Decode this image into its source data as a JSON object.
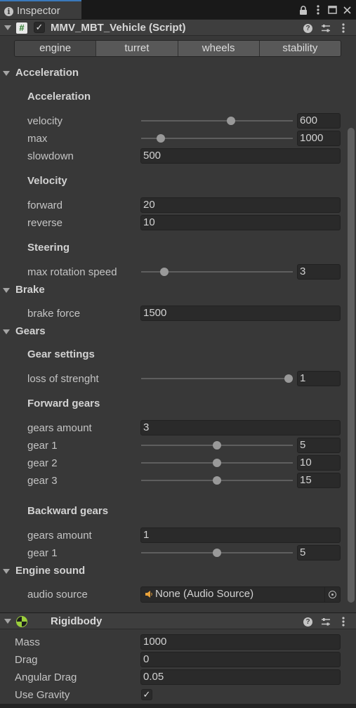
{
  "window": {
    "tab_title": "Inspector",
    "tools": [
      "lock-icon",
      "menu-icon",
      "maximize-icon",
      "close-icon"
    ]
  },
  "script_component": {
    "enabled": "✓",
    "title": "MMV_MBT_Vehicle (Script)"
  },
  "toolbar": {
    "tabs": [
      "engine",
      "turret",
      "wheels",
      "stability"
    ],
    "selected": "engine"
  },
  "acceleration": {
    "foldout": "Acceleration",
    "header": "Acceleration",
    "velocity_label": "velocity",
    "velocity_value": "600",
    "velocity_level": 0.6,
    "max_label": "max",
    "max_value": "1000",
    "max_level": 0.11,
    "slowdown_label": "slowdown",
    "slowdown_value": "500",
    "velocity_header": "Velocity",
    "forward_label": "forward",
    "forward_value": "20",
    "reverse_label": "reverse",
    "reverse_value": "10",
    "steering_header": "Steering",
    "max_rotation_label": "max rotation speed",
    "max_rotation_value": "3",
    "max_rotation_level": 0.13
  },
  "brake": {
    "foldout": "Brake",
    "brake_force_label": "brake force",
    "brake_force_value": "1500"
  },
  "gears": {
    "foldout": "Gears",
    "settings_header": "Gear settings",
    "loss_label": "loss of strenght",
    "loss_value": "1",
    "loss_level": 1.0,
    "forward_header": "Forward gears",
    "forward_amount_label": "gears amount",
    "forward_amount_value": "3",
    "forward_gears": [
      {
        "label": "gear 1",
        "value": "5",
        "level": 0.5
      },
      {
        "label": "gear 2",
        "value": "10",
        "level": 0.5
      },
      {
        "label": "gear 3",
        "value": "15",
        "level": 0.5
      }
    ],
    "backward_header": "Backward gears",
    "backward_amount_label": "gears amount",
    "backward_amount_value": "1",
    "backward_gears": [
      {
        "label": "gear 1",
        "value": "5",
        "level": 0.5
      }
    ]
  },
  "engine_sound": {
    "foldout": "Engine sound",
    "audio_source_label": "audio source",
    "audio_source_value": "None (Audio Source)"
  },
  "rigidbody": {
    "title": "Rigidbody",
    "mass_label": "Mass",
    "mass_value": "1000",
    "drag_label": "Drag",
    "drag_value": "0",
    "angular_drag_label": "Angular Drag",
    "angular_drag_value": "0.05",
    "use_gravity_label": "Use Gravity",
    "use_gravity_check": "✓"
  },
  "colors": {
    "panel_bg": "#383838",
    "field_bg": "#2a2a2a",
    "active_tab_accent": "#3a79bb",
    "rigidbody_icon": "#9bcf3c"
  }
}
